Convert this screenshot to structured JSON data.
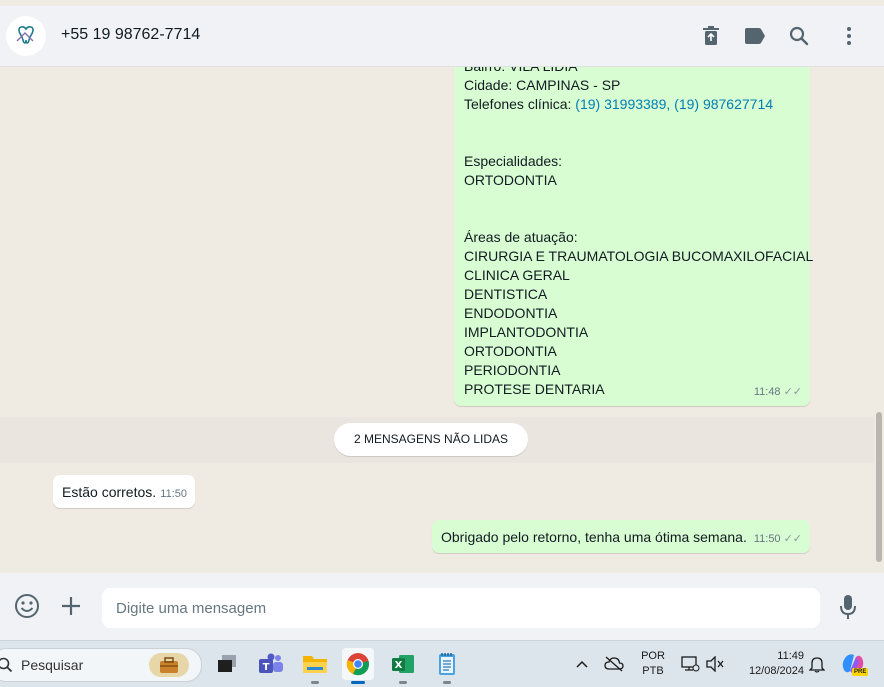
{
  "header": {
    "contact_name": "+55 19 98762-7714",
    "icons": [
      "dentist-logo-icon",
      "delete-icon",
      "label-icon",
      "search-icon",
      "menu-icon"
    ]
  },
  "messages": {
    "outgoing_1": {
      "lines_plain": [
        {
          "text": "Bairro: VILA LIDIA"
        },
        {
          "text": "Cidade: CAMPINAS - SP"
        }
      ],
      "phones_label": "Telefones clínica: ",
      "phones_value": "(19) 31993389, (19) 987627714",
      "specialties_label": "Especialidades:",
      "specialties_value": "ORTODONTIA",
      "areas_label": "Áreas de atuação:",
      "areas": [
        "CIRURGIA E TRAUMATOLOGIA BUCOMAXILOFACIAL",
        "CLINICA GERAL",
        "DENTISTICA",
        "ENDODONTIA",
        "IMPLANTODONTIA",
        "ORTODONTIA",
        "PERIODONTIA",
        "PROTESE DENTARIA"
      ],
      "time": "11:48"
    },
    "unread_divider": "2 MENSAGENS NÃO LIDAS",
    "incoming_1": {
      "text": "Estão corretos.",
      "time": "11:50"
    },
    "outgoing_2": {
      "text": "Obrigado pelo retorno, tenha uma ótima semana.",
      "time": "11:50"
    }
  },
  "composer": {
    "placeholder": "Digite uma mensagem"
  },
  "taskbar": {
    "search_label": "Pesquisar",
    "language_top": "POR",
    "language_bottom": "PTB",
    "time": "11:49",
    "date": "12/08/2024",
    "copilot_badge": "PRE"
  },
  "colors": {
    "outgoing_bubble": "#d9fdd3",
    "incoming_bubble": "#ffffff",
    "chat_background": "#efeae2",
    "link": "#027eb5"
  }
}
